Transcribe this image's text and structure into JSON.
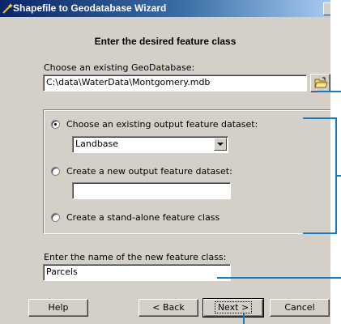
{
  "window": {
    "title": "Shapefile to Geodatabase Wizard"
  },
  "heading": "Enter the desired feature class",
  "geodatabase": {
    "label": "Choose an existing GeoDatabase:",
    "value": "C:\\data\\WaterData\\Montgomery.mdb"
  },
  "options": {
    "existing_dataset": {
      "label": "Choose an existing output feature dataset:",
      "selected": true
    },
    "dataset_dropdown": {
      "value": "Landbase"
    },
    "new_dataset": {
      "label": "Create a new output feature dataset:",
      "value": ""
    },
    "standalone": {
      "label": "Create a stand-alone feature class"
    }
  },
  "feature_class": {
    "label": "Enter the name of the new feature class:",
    "value": "Parcels"
  },
  "buttons": {
    "help": "Help",
    "back": "< Back",
    "next": "Next >",
    "cancel": "Cancel"
  },
  "colors": {
    "callout": "#1479c6",
    "dialog_bg": "#d4d0c8",
    "titlebar": "#0a246a"
  },
  "icons": {
    "title": "wizard-icon",
    "browse": "open-folder-icon",
    "dropdown": "chevron-down-icon"
  }
}
